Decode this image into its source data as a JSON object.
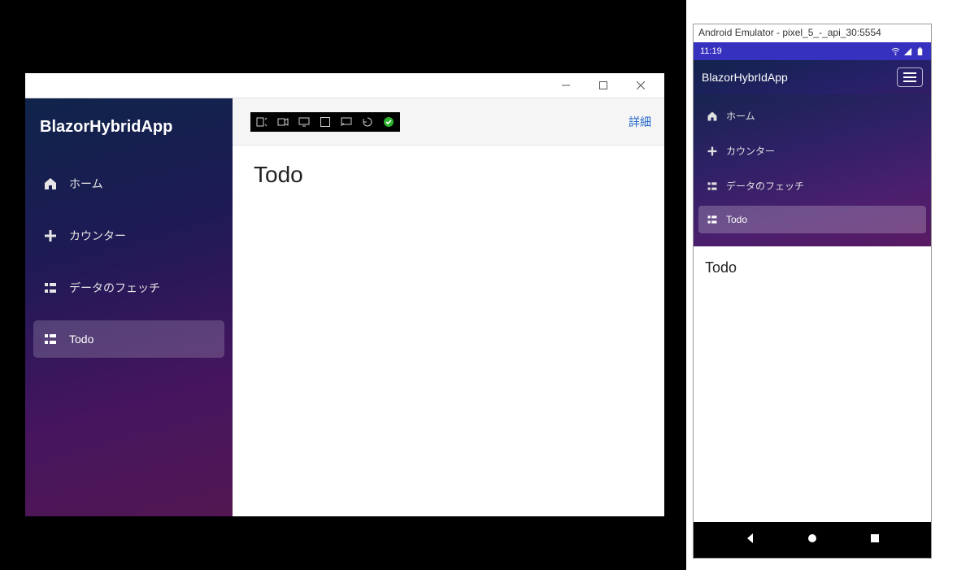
{
  "desktop": {
    "brand": "BlazorHybridApp",
    "details_link": "詳細",
    "page_title": "Todo",
    "nav": [
      {
        "label": "ホーム",
        "icon": "home",
        "active": false
      },
      {
        "label": "カウンター",
        "icon": "plus",
        "active": false
      },
      {
        "label": "データのフェッチ",
        "icon": "list",
        "active": false
      },
      {
        "label": "Todo",
        "icon": "list",
        "active": true
      }
    ]
  },
  "mobile": {
    "emulator_title": "Android Emulator - pixel_5_-_api_30:5554",
    "status_time": "11:19",
    "brand": "BlazorHybrIdApp",
    "page_title": "Todo",
    "nav": [
      {
        "label": "ホーム",
        "icon": "home",
        "active": false
      },
      {
        "label": "カウンター",
        "icon": "plus",
        "active": false
      },
      {
        "label": "データのフェッチ",
        "icon": "list",
        "active": false
      },
      {
        "label": "Todo",
        "icon": "list",
        "active": true
      }
    ]
  }
}
